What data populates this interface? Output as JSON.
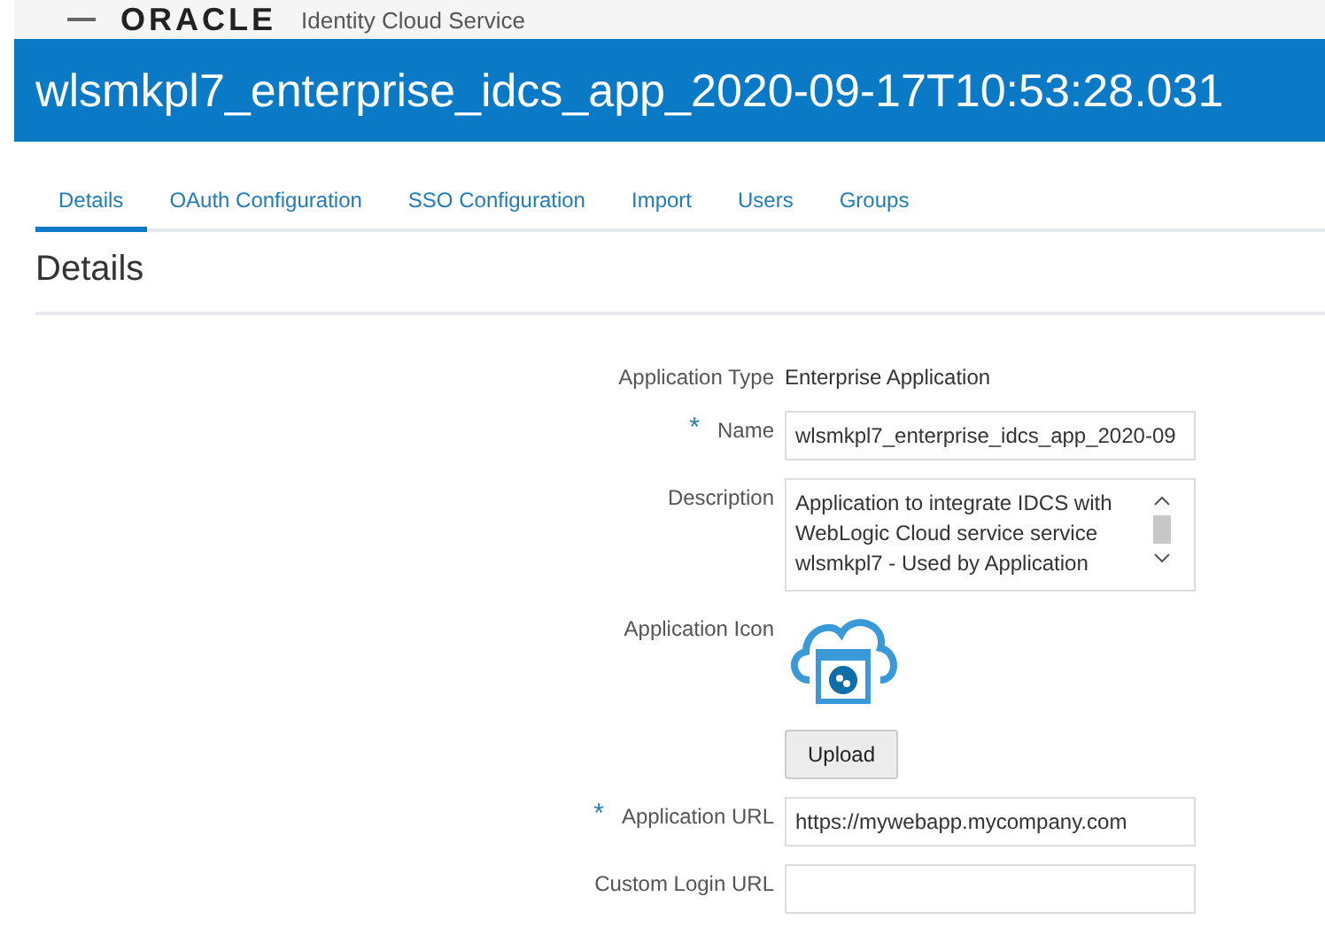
{
  "header": {
    "logo": "ORACLE",
    "product": "Identity Cloud Service"
  },
  "title": "wlsmkpl7_enterprise_idcs_app_2020-09-17T10:53:28.031",
  "tabs": [
    {
      "label": "Details",
      "selected": true
    },
    {
      "label": "OAuth Configuration",
      "selected": false
    },
    {
      "label": "SSO Configuration",
      "selected": false
    },
    {
      "label": "Import",
      "selected": false
    },
    {
      "label": "Users",
      "selected": false
    },
    {
      "label": "Groups",
      "selected": false
    }
  ],
  "section_title": "Details",
  "fields": [
    {
      "kind": "static",
      "label": "Application Type",
      "value": "Enterprise Application"
    },
    {
      "kind": "text",
      "label": "Name",
      "required_mark": "*",
      "value": "wlsmkpl7_enterprise_idcs_app_2020-09"
    },
    {
      "kind": "textarea",
      "label": "Description",
      "value": "Application to integrate IDCS with WebLogic Cloud service service wlsmkpl7 - Used by Application"
    },
    {
      "kind": "icon",
      "label": "Application Icon",
      "button": "Upload"
    },
    {
      "kind": "text",
      "label": "Application URL",
      "required_mark": "*",
      "value": "https://mywebapp.mycompany.com"
    },
    {
      "kind": "text",
      "label": "Custom Login URL"
    }
  ]
}
